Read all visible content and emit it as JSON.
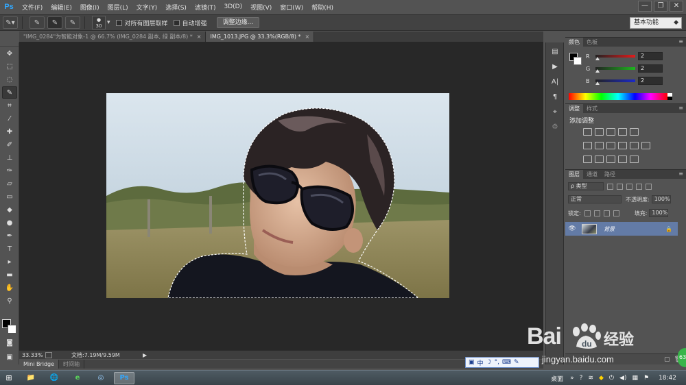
{
  "app": {
    "logo": "Ps"
  },
  "menu": [
    "文件(F)",
    "编辑(E)",
    "图像(I)",
    "图层(L)",
    "文字(Y)",
    "选择(S)",
    "滤镜(T)",
    "3D(D)",
    "视图(V)",
    "窗口(W)",
    "帮助(H)"
  ],
  "window_controls": {
    "minimize": "—",
    "restore": "❐",
    "close": "✕"
  },
  "options": {
    "brush_size": "30",
    "sample_all_layers": "对所有图层取样",
    "auto_enhance": "自动增强",
    "refine_edge": "调整边缘...",
    "workspace": "基本功能"
  },
  "tabs": [
    {
      "label": "\"IMG_0284\"为智能对象-1 @ 66.7% (IMG_0284 副本, 绿 副本/8) *",
      "close": "×"
    },
    {
      "label": "IMG_1013.JPG @ 33.3%(RGB/8) *",
      "close": "×"
    }
  ],
  "status": {
    "zoom": "33.33%",
    "doc": "文档:7.19M/9.59M",
    "arrow": "▶"
  },
  "bottom_tabs": [
    "Mini Bridge",
    "时间轴"
  ],
  "color_panel": {
    "tabs": [
      "颜色",
      "色板"
    ],
    "channels": [
      {
        "label": "R",
        "value": "2",
        "color": "#e31b1b"
      },
      {
        "label": "G",
        "value": "2",
        "color": "#1fb51f"
      },
      {
        "label": "B",
        "value": "2",
        "color": "#1b29c9"
      }
    ]
  },
  "adjust_panel": {
    "tabs": [
      "调整",
      "样式"
    ],
    "title": "添加调整"
  },
  "layers_panel": {
    "tabs": [
      "图层",
      "通道",
      "路径"
    ],
    "filter": "ρ 类型",
    "blend_mode": "正常",
    "opacity_label": "不透明度:",
    "opacity_value": "100%",
    "lock_label": "锁定:",
    "fill_label": "填充:",
    "fill_value": "100%",
    "layer_name": "背景",
    "eye": "👁",
    "lock": "🔒"
  },
  "ime": {
    "items": [
      "中",
      "☽",
      "°,",
      "⌨",
      "✎"
    ]
  },
  "watermark": {
    "logo": "Bai",
    "chinese": "经验",
    "url": "jingyan.baidu.com",
    "badge": "63"
  },
  "taskbar": {
    "desktop": "桌面",
    "clock": "18:42",
    "apps": [
      "📁",
      "🌐",
      "e",
      "◎",
      "Ps"
    ]
  },
  "colors": {
    "accent": "#31a8ff",
    "selected_layer": "#637ba6"
  }
}
